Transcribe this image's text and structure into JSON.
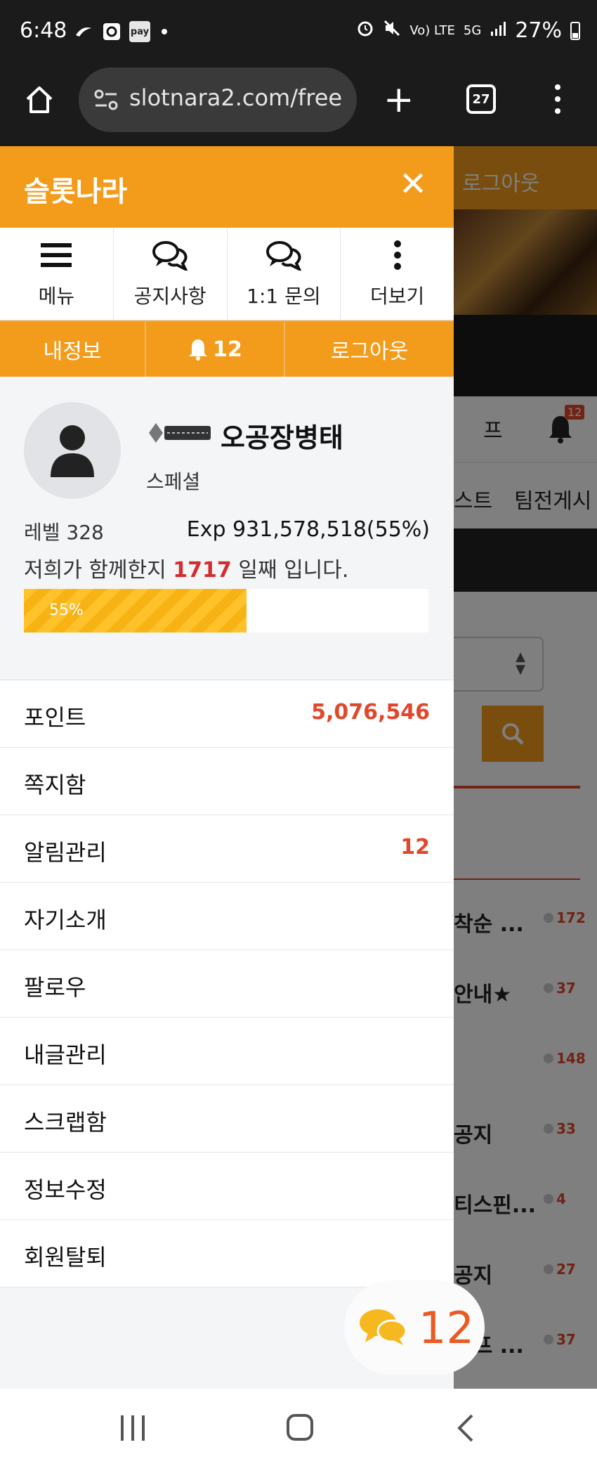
{
  "status_bar": {
    "time": "6:48",
    "network": "Vo) LTE",
    "signal": "5G",
    "battery": "27%"
  },
  "browser": {
    "url": "slotnara2.com/free",
    "tab_count": "27"
  },
  "background_page": {
    "logout": "로그아웃",
    "tab_partial": "프",
    "bell_badge": "12",
    "nav_a": "스트",
    "nav_b": "팀전게시",
    "list": [
      {
        "title": "착순 ...",
        "count": "172"
      },
      {
        "title": "안내★",
        "count": "37"
      },
      {
        "title": "",
        "count": "148"
      },
      {
        "title": "공지",
        "count": "33"
      },
      {
        "title": "티스핀...",
        "count": "4"
      },
      {
        "title": "공지",
        "count": "27"
      },
      {
        "title": "터프 ...",
        "count": "37"
      }
    ]
  },
  "drawer": {
    "title": "슬롯나라",
    "quick_nav": [
      {
        "label": "메뉴",
        "icon": "hamburger-icon"
      },
      {
        "label": "공지사항",
        "icon": "chat-icon"
      },
      {
        "label": "1:1 문의",
        "icon": "chat-icon"
      },
      {
        "label": "더보기",
        "icon": "kebab-icon"
      }
    ],
    "user_bar": {
      "my_info": "내정보",
      "notifications": "12",
      "logout": "로그아웃"
    },
    "profile": {
      "nickname": "오공장병태",
      "grade": "스페셜",
      "level": "레벨 328",
      "exp": "Exp 931,578,518(55%)",
      "days_prefix": "저희가 함께한지",
      "days": "1717",
      "days_suffix": "일째 입니다.",
      "progress_label": "55%",
      "progress": 0.55
    },
    "menu": [
      {
        "label": "포인트",
        "value": "5,076,546"
      },
      {
        "label": "쪽지함",
        "value": ""
      },
      {
        "label": "알림관리",
        "value": "12"
      },
      {
        "label": "자기소개",
        "value": ""
      },
      {
        "label": "팔로우",
        "value": ""
      },
      {
        "label": "내글관리",
        "value": ""
      },
      {
        "label": "스크랩함",
        "value": ""
      },
      {
        "label": "정보수정",
        "value": ""
      },
      {
        "label": "회원탈퇴",
        "value": ""
      }
    ]
  },
  "chat_fab": {
    "count": "12"
  },
  "colors": {
    "accent": "#f39b1a",
    "alert": "#e2462b",
    "days": "#d42d2d"
  }
}
